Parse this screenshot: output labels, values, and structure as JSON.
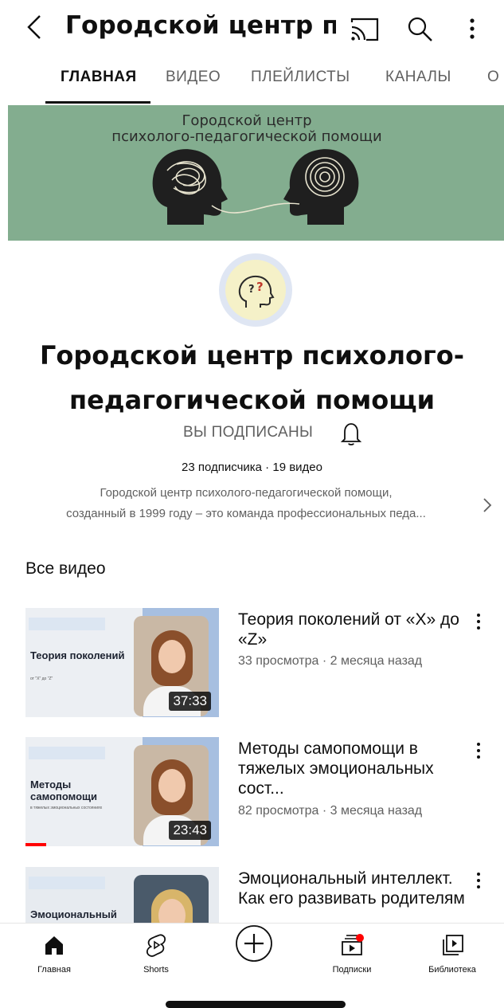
{
  "header": {
    "title": "Городской центр пси...",
    "back_icon": "chevron-left-icon",
    "cast_icon": "cast-icon",
    "search_icon": "search-icon",
    "more_icon": "more-vertical-icon"
  },
  "tabs": [
    {
      "label": "ГЛАВНАЯ",
      "active": true
    },
    {
      "label": "ВИДЕО",
      "active": false
    },
    {
      "label": "ПЛЕЙЛИСТЫ",
      "active": false
    },
    {
      "label": "КАНАЛЫ",
      "active": false
    },
    {
      "label": "О К",
      "active": false
    }
  ],
  "banner": {
    "line1": "Городской центр",
    "line2": "психолого-педагогической помощи",
    "background": "#83ad8f"
  },
  "channel": {
    "name_line1": "Городской центр психолого-",
    "name_line2": "педагогической помощи",
    "subscribed_label": "ВЫ ПОДПИСАНЫ",
    "bell_icon": "bell-icon",
    "stats": "23 подписчика · 19 видео",
    "description_line1": "Городской  центр психолого-педагогической  помощи,",
    "description_line2": "созданный в 1999 году – это команда профессиональных педа...",
    "chevron_icon": "chevron-right-icon"
  },
  "section": {
    "title": "Все видео"
  },
  "videos": [
    {
      "title": "Теория поколений от «X» до «Z»",
      "meta": "33 просмотра · 2 месяца назад",
      "duration": "37:33",
      "thumb_heading": "Теория поколений",
      "thumb_sub": "от \"X\" до \"Z\""
    },
    {
      "title": "Методы самопомощи в тяжелых эмоциональных сост...",
      "meta": "82 просмотра · 3 месяца назад",
      "duration": "23:43",
      "thumb_heading": "Методы самопомощи",
      "thumb_sub": "в тяжелых эмоциональных состояниях"
    },
    {
      "title": "Эмоциональный интеллект. Как его развивать родителям",
      "meta": "",
      "duration": "",
      "thumb_heading": "Эмоциональный",
      "thumb_sub": ""
    }
  ],
  "bottom_nav": [
    {
      "label": "Главная",
      "icon": "home-icon"
    },
    {
      "label": "Shorts",
      "icon": "shorts-icon"
    },
    {
      "label": "",
      "icon": "create-plus-icon"
    },
    {
      "label": "Подписки",
      "icon": "subscriptions-icon"
    },
    {
      "label": "Библиотека",
      "icon": "library-icon"
    }
  ],
  "colors": {
    "accent_red": "#ff0000",
    "text_primary": "#0f0f0f",
    "text_secondary": "#606060"
  }
}
